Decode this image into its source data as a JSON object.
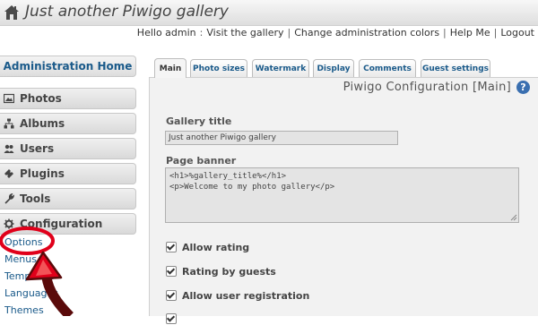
{
  "header": {
    "title": "Just another Piwigo gallery",
    "hello": "Hello admin",
    "links": [
      "Visit the gallery",
      "Change administration colors",
      "Help Me",
      "Logout"
    ]
  },
  "sidebar": {
    "home": "Administration Home",
    "sections": [
      {
        "label": "Photos",
        "icon": "photos-icon"
      },
      {
        "label": "Albums",
        "icon": "albums-icon"
      },
      {
        "label": "Users",
        "icon": "users-icon"
      },
      {
        "label": "Plugins",
        "icon": "plugins-icon"
      },
      {
        "label": "Tools",
        "icon": "tools-icon"
      },
      {
        "label": "Configuration",
        "icon": "gear-icon"
      }
    ],
    "sub_items": [
      "Options",
      "Menus",
      "Templates",
      "Languages",
      "Themes"
    ]
  },
  "tabs": [
    "Main",
    "Photo sizes",
    "Watermark",
    "Display",
    "Comments",
    "Guest settings"
  ],
  "active_tab": "Main",
  "panel": {
    "title": "Piwigo Configuration [Main]",
    "gallery_title_label": "Gallery title",
    "gallery_title_value": "Just another Piwigo gallery",
    "page_banner_label": "Page banner",
    "page_banner_lines": [
      "<h1>%gallery_title%</h1>",
      "",
      "<p>Welcome to my photo gallery</p>"
    ],
    "checkboxes": [
      {
        "label": "Allow rating",
        "checked": true
      },
      {
        "label": "Rating by guests",
        "checked": true
      },
      {
        "label": "Allow user registration",
        "checked": true
      }
    ]
  },
  "colors": {
    "link": "#1a5a8a",
    "annotation_red": "#e0001a",
    "annotation_arrow": "#5a0a0a",
    "help_icon": "#3a6fb0"
  }
}
